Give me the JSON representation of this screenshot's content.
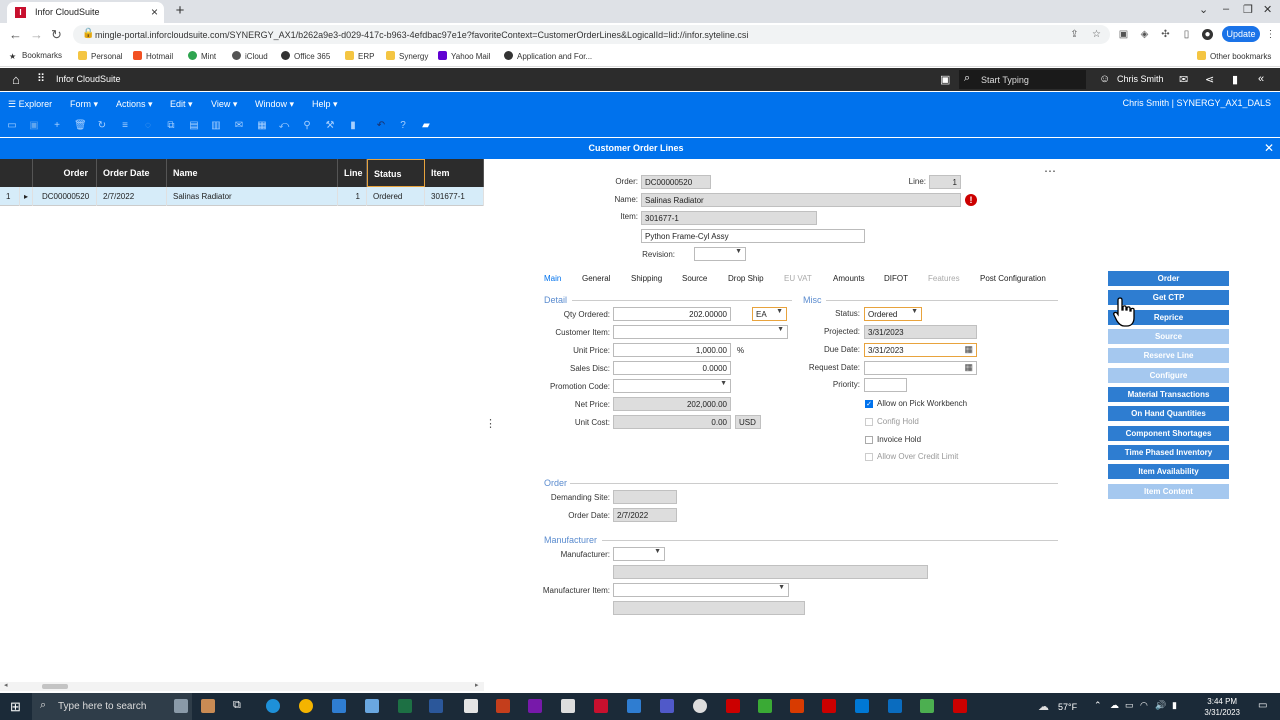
{
  "browser": {
    "tab_title": "Infor CloudSuite",
    "url": "mingle-portal.inforcloudsuite.com/SYNERGY_AX1/b262a9e3-d029-417c-b963-4efdbac97e1e?favoriteContext=CustomerOrderLines&LogicalId=lid://infor.syteline.csi",
    "update_label": "Update",
    "bookmarks": [
      "Bookmarks",
      "Personal",
      "Hotmail",
      "Mint",
      "iCloud",
      "Office 365",
      "ERP",
      "Synergy",
      "Yahoo Mail",
      "Application and For..."
    ],
    "other_bookmarks": "Other bookmarks"
  },
  "infor_header": {
    "app_name": "Infor CloudSuite",
    "search_placeholder": "Start Typing",
    "user": "Chris Smith"
  },
  "menubar": {
    "items": [
      "Explorer",
      "Form",
      "Actions",
      "Edit",
      "View",
      "Window",
      "Help"
    ],
    "user_info": "Chris Smith | SYNERGY_AX1_DALS"
  },
  "form_title": "Customer Order Lines",
  "grid": {
    "columns": [
      "Order",
      "Order Date",
      "Name",
      "Line",
      "Status",
      "Item"
    ],
    "row": {
      "index": "1",
      "order": "DC00000520",
      "order_date": "2/7/2022",
      "name": "Salinas Radiator",
      "line": "1",
      "status": "Ordered",
      "item": "301677-1"
    }
  },
  "header_fields": {
    "order_label": "Order:",
    "order_value": "DC00000520",
    "line_label": "Line:",
    "line_value": "1",
    "name_label": "Name:",
    "name_value": "Salinas Radiator",
    "item_label": "Item:",
    "item_value": "301677-1",
    "item_desc": "Python Frame-Cyl Assy",
    "revision_label": "Revision:"
  },
  "tabs": [
    "Main",
    "General",
    "Shipping",
    "Source",
    "Drop Ship",
    "EU VAT",
    "Amounts",
    "DIFOT",
    "Features",
    "Post Configuration"
  ],
  "detail": {
    "section": "Detail",
    "qty_label": "Qty Ordered:",
    "qty_value": "202.00000",
    "uom": "EA",
    "cust_item_label": "Customer Item:",
    "unit_price_label": "Unit Price:",
    "unit_price_value": "1,000.00",
    "pct": "%",
    "sales_disc_label": "Sales Disc:",
    "sales_disc_value": "0.0000",
    "promo_label": "Promotion Code:",
    "net_price_label": "Net Price:",
    "net_price_value": "202,000.00",
    "unit_cost_label": "Unit Cost:",
    "unit_cost_value": "0.00",
    "currency": "USD"
  },
  "misc": {
    "section": "Misc",
    "status_label": "Status:",
    "status_value": "Ordered",
    "projected_label": "Projected:",
    "projected_value": "3/31/2023",
    "due_date_label": "Due Date:",
    "due_date_value": "3/31/2023",
    "request_date_label": "Request Date:",
    "priority_label": "Priority:",
    "checkboxes": [
      "Allow on Pick Workbench",
      "Config Hold",
      "Invoice Hold",
      "Allow Over Credit Limit"
    ]
  },
  "order_section": {
    "section": "Order",
    "demanding_site_label": "Demanding Site:",
    "order_date_label": "Order Date:",
    "order_date_value": "2/7/2022"
  },
  "manufacturer_section": {
    "section": "Manufacturer",
    "manufacturer_label": "Manufacturer:",
    "manufacturer_item_label": "Manufacturer Item:"
  },
  "action_buttons": [
    "Order",
    "Get CTP",
    "Reprice",
    "Source",
    "Reserve Line",
    "Configure",
    "Material Transactions",
    "On Hand Quantities",
    "Component Shortages",
    "Time Phased Inventory",
    "Item Availability",
    "Item Content"
  ],
  "taskbar": {
    "search_placeholder": "Type here to search",
    "weather": "57°F",
    "time": "3:44 PM",
    "date": "3/31/2023"
  },
  "colors": {
    "infor_blue": "#0072ed",
    "header_dark": "#2c2c2c",
    "button_blue": "#2e7dd1",
    "button_disabled": "#a5c8ef"
  }
}
